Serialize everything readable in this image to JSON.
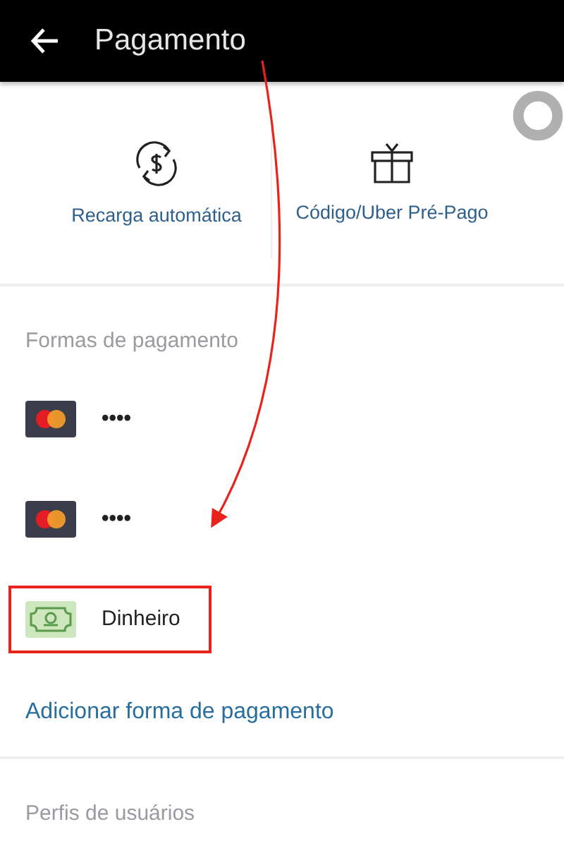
{
  "header": {
    "title": "Pagamento"
  },
  "shortcuts": [
    {
      "kind": "autoreload",
      "label": "Recarga automática"
    },
    {
      "kind": "gift",
      "label": "Código/Uber Pré-Pago"
    },
    {
      "kind": "ring"
    }
  ],
  "payment_section": {
    "heading": "Formas de pagamento",
    "methods": [
      {
        "kind": "card",
        "label": "••••",
        "highlighted": false
      },
      {
        "kind": "card",
        "label": "••••",
        "highlighted": false
      },
      {
        "kind": "cash",
        "label": "Dinheiro",
        "highlighted": true
      }
    ],
    "add_link": "Adicionar forma de pagamento"
  },
  "profiles_section": {
    "heading": "Perfis de usuários"
  }
}
